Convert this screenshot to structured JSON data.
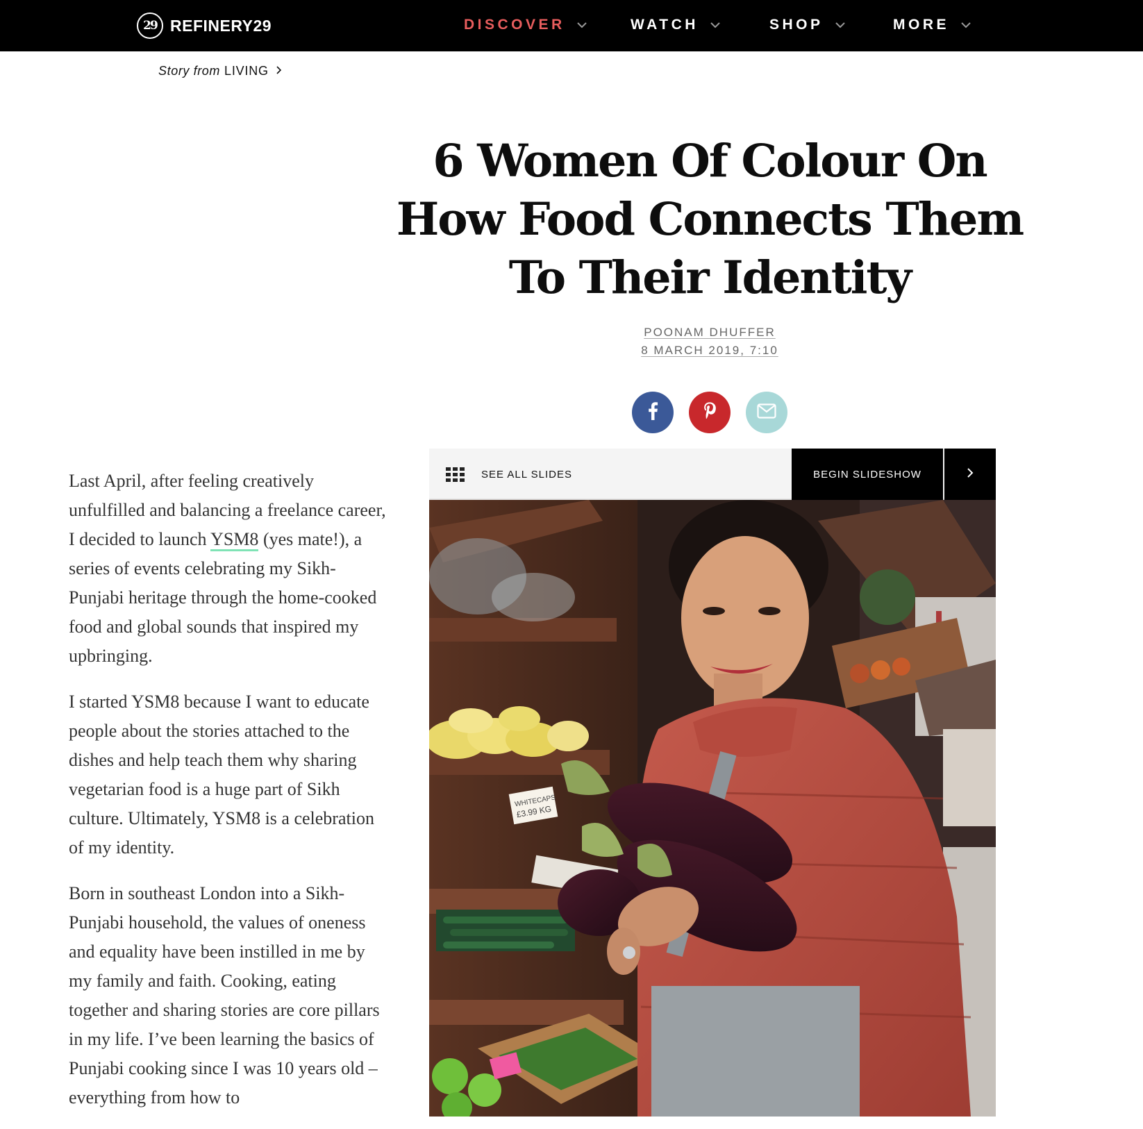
{
  "nav": {
    "logo_mark": "29",
    "logo_text": "REFINERY29",
    "items": [
      {
        "label": "DISCOVER"
      },
      {
        "label": "WATCH"
      },
      {
        "label": "SHOP"
      },
      {
        "label": "MORE"
      }
    ]
  },
  "story_from": {
    "prefix": "Story from",
    "category": "LIVING"
  },
  "article": {
    "title": "6 Women Of Colour On How Food Connects Them To Their Identity",
    "author": "POONAM DHUFFER",
    "date": "8 MARCH 2019, 7:10",
    "paragraphs": {
      "p1_before": "Last April, after feeling creatively unfulfilled and balancing a freelance career, I decided to launch ",
      "p1_link": "YSM8",
      "p1_after": " (yes mate!), a series of events celebrating my Sikh-Punjabi heritage through the home-cooked food and global sounds that inspired my upbringing.",
      "p2": "I started YSM8 because I want to educate people about the stories attached to the dishes and help teach them why sharing vegetarian food is a huge part of Sikh culture. Ultimately, YSM8 is a celebration of my identity.",
      "p3": "Born in southeast London into a Sikh-Punjabi household, the values of oneness and equality have been instilled in me by my family and faith. Cooking, eating together and sharing stories are core pillars in my life. I’ve been learning the basics of Punjabi cooking since I was 10 years old – everything from how to"
    }
  },
  "social": {
    "facebook": "facebook-icon",
    "pinterest": "pinterest-icon",
    "email": "mail-icon"
  },
  "slideshow": {
    "see_all_label": "SEE ALL SLIDES",
    "begin_label": "BEGIN SLIDESHOW",
    "price_tag_line1": "WHITECAPS",
    "price_tag_line2": "£3.99 KG"
  },
  "colors": {
    "nav_bg": "#000000",
    "discover": "#e85d5d",
    "facebook": "#3b5998",
    "pinterest": "#c8282c",
    "email": "#a8d8d8",
    "link_underline": "#7fe3b5"
  }
}
